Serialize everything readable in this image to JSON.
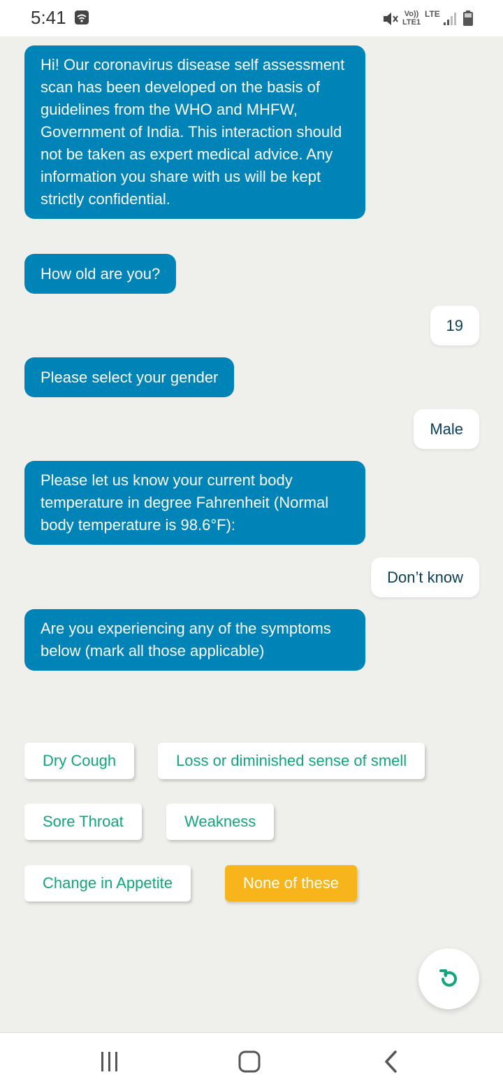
{
  "status_bar": {
    "time": "5:41",
    "volte_line1": "Vo))",
    "volte_line2": "LTE1",
    "network": "LTE"
  },
  "chat": {
    "intro": "Hi! Our coronavirus disease self assessment scan has been developed on the basis of guidelines from the WHO and MHFW, Government of India. This interaction should not be taken as expert medical advice. Any information you share with us will be kept strictly confidential.",
    "age_question": "How old are you?",
    "age_answer": "19",
    "gender_question": "Please select your gender",
    "gender_answer": "Male",
    "temperature_question": "Please let us know your current body temperature in degree Fahrenheit (Normal body temperature is 98.6°F):",
    "temperature_answer": "Don’t know",
    "symptoms_question": "Are you experiencing any of the symptoms below (mark all those applicable)"
  },
  "options": {
    "dry_cough": "Dry Cough",
    "smell": "Loss or diminished sense of smell",
    "sore_throat": "Sore Throat",
    "weakness": "Weakness",
    "appetite": "Change in Appetite",
    "none": "None of these"
  },
  "colors": {
    "bot_bubble": "#0084b8",
    "option_text": "#11a57d",
    "selected_option": "#f8b51b",
    "background": "#efefec"
  },
  "icons": {
    "refresh": "refresh-icon",
    "recents": "recents-icon",
    "home": "home-icon",
    "back": "back-icon"
  }
}
